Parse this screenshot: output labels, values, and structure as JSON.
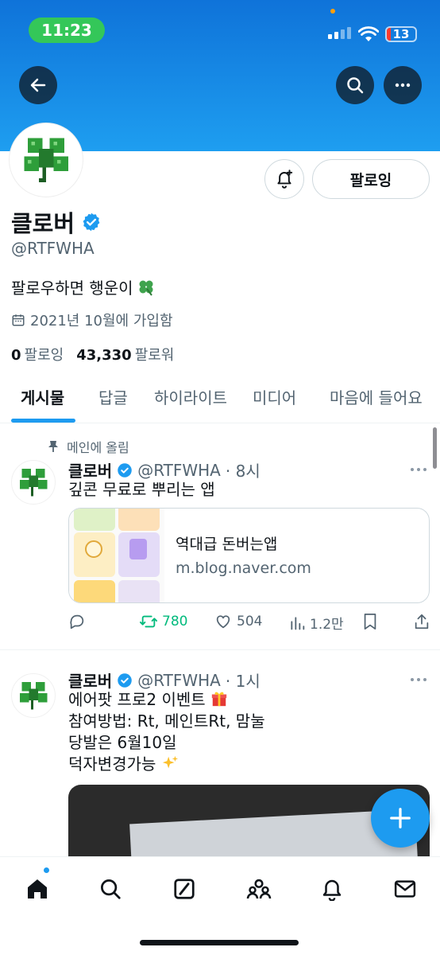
{
  "status_bar": {
    "time": "11:23",
    "battery": "13",
    "battery_level": 0.13,
    "battery_color": "#ff3b30"
  },
  "profile": {
    "name": "클로버",
    "handle": "@RTFWHA",
    "bio": "팔로우하면 행운이",
    "bio_emoji": "clover-emoji",
    "joined": "2021년 10월에 가입함",
    "following_count": "0",
    "following_label": "팔로잉",
    "followers_count": "43,330",
    "followers_label": "팔로워",
    "follow_button": "팔로잉",
    "accent": "#1d9bf0"
  },
  "tabs": [
    {
      "label": "게시물",
      "active": true
    },
    {
      "label": "답글",
      "active": false
    },
    {
      "label": "하이라이트",
      "active": false
    },
    {
      "label": "미디어",
      "active": false
    },
    {
      "label": "마음에 들어요",
      "active": false
    }
  ],
  "posts": [
    {
      "pinned_label": "메인에 올림",
      "name": "클로버",
      "handle": "@RTFWHA",
      "time": "· 8시",
      "text": "깊콘 무료로 뿌리는 앱",
      "card": {
        "title": "역대급 돈버는앱",
        "domain": "m.blog.naver.com"
      },
      "replies": "",
      "retweets": "780",
      "likes": "504",
      "views": "1.2만",
      "retweet_color": "#00ba7c"
    },
    {
      "name": "클로버",
      "handle": "@RTFWHA",
      "time": "· 1시",
      "lines": [
        "에어팟 프로2 이벤트",
        "참여방법: Rt, 메인트Rt, 맘눌",
        "당발은 6월10일",
        "덕자변경가능"
      ],
      "line_emojis": [
        "gift-emoji",
        "",
        "",
        "sparkles-emoji"
      ]
    }
  ],
  "bottom_nav": [
    "home-icon",
    "search-icon",
    "grok-icon",
    "communities-icon",
    "notifications-icon",
    "messages-icon"
  ]
}
